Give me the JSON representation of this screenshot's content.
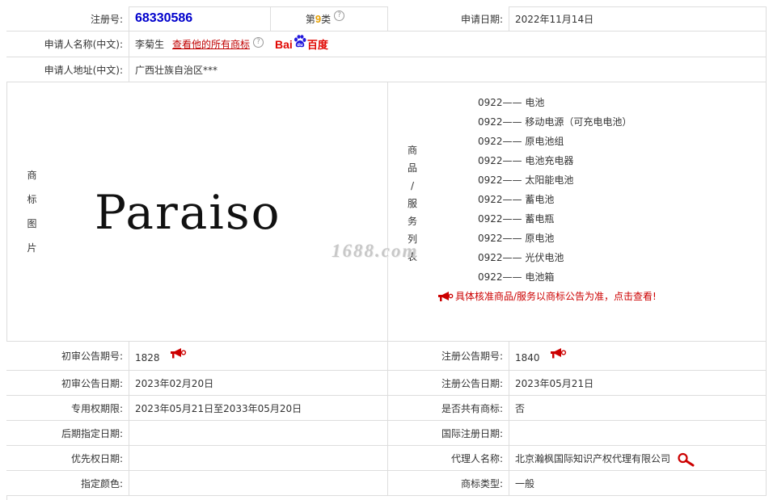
{
  "registration": {
    "reg_no_label": "注册号:",
    "reg_no": "68330586",
    "class_prefix": "第",
    "class_num": "9",
    "class_suffix": "类",
    "apply_date_label": "申请日期:",
    "apply_date": "2022年11月14日"
  },
  "applicant": {
    "name_label": "申请人名称(中文):",
    "name": "李菊生",
    "view_all_link": "查看他的所有商标",
    "baidu_text": "Bai",
    "baidu_cn": "百度",
    "address_label": "申请人地址(中文):",
    "address": "广西壮族自治区***"
  },
  "trademark": {
    "image_label": [
      "商",
      "标",
      "图",
      "片"
    ],
    "mark_text": "Paraiso",
    "watermark": "1688.com",
    "goods_label": [
      "商",
      "品",
      "/",
      "服",
      "务",
      "列",
      "表"
    ],
    "goods": [
      {
        "code": "0922",
        "dash": "——",
        "name": "电池"
      },
      {
        "code": "0922",
        "dash": "——",
        "name": "移动电源（可充电电池）"
      },
      {
        "code": "0922",
        "dash": "——",
        "name": "原电池组"
      },
      {
        "code": "0922",
        "dash": "——",
        "name": "电池充电器"
      },
      {
        "code": "0922",
        "dash": "——",
        "name": "太阳能电池"
      },
      {
        "code": "0922",
        "dash": "——",
        "name": "蓄电池"
      },
      {
        "code": "0922",
        "dash": "——",
        "name": "蓄电瓶"
      },
      {
        "code": "0922",
        "dash": "——",
        "name": "原电池"
      },
      {
        "code": "0922",
        "dash": "——",
        "name": "光伏电池"
      },
      {
        "code": "0922",
        "dash": "——",
        "name": "电池箱"
      }
    ],
    "notice": "具体核准商品/服务以商标公告为准，点击查看!"
  },
  "details": {
    "prelim_pub_no_label": "初审公告期号:",
    "prelim_pub_no": "1828",
    "reg_pub_no_label": "注册公告期号:",
    "reg_pub_no": "1840",
    "prelim_pub_date_label": "初审公告日期:",
    "prelim_pub_date": "2023年02月20日",
    "reg_pub_date_label": "注册公告日期:",
    "reg_pub_date": "2023年05月21日",
    "exclusive_period_label": "专用权期限:",
    "exclusive_period": "2023年05月21日至2033年05月20日",
    "shared_label": "是否共有商标:",
    "shared": "否",
    "later_designation_label": "后期指定日期:",
    "later_designation": "",
    "intl_reg_date_label": "国际注册日期:",
    "intl_reg_date": "",
    "priority_date_label": "优先权日期:",
    "priority_date": "",
    "agent_label": "代理人名称:",
    "agent": "北京瀚枫国际知识产权代理有限公司",
    "color_label": "指定颜色:",
    "color": "",
    "type_label": "商标类型:",
    "type": "一般"
  },
  "colors": {
    "reg_no": "#0000cc",
    "class_num": "#e6a000",
    "link_red": "#c00000",
    "notice_red": "#cc0000",
    "border": "#dddddd"
  },
  "icons": [
    "help-icon",
    "baidu-logo",
    "horn-icon",
    "magnifier-icon"
  ]
}
